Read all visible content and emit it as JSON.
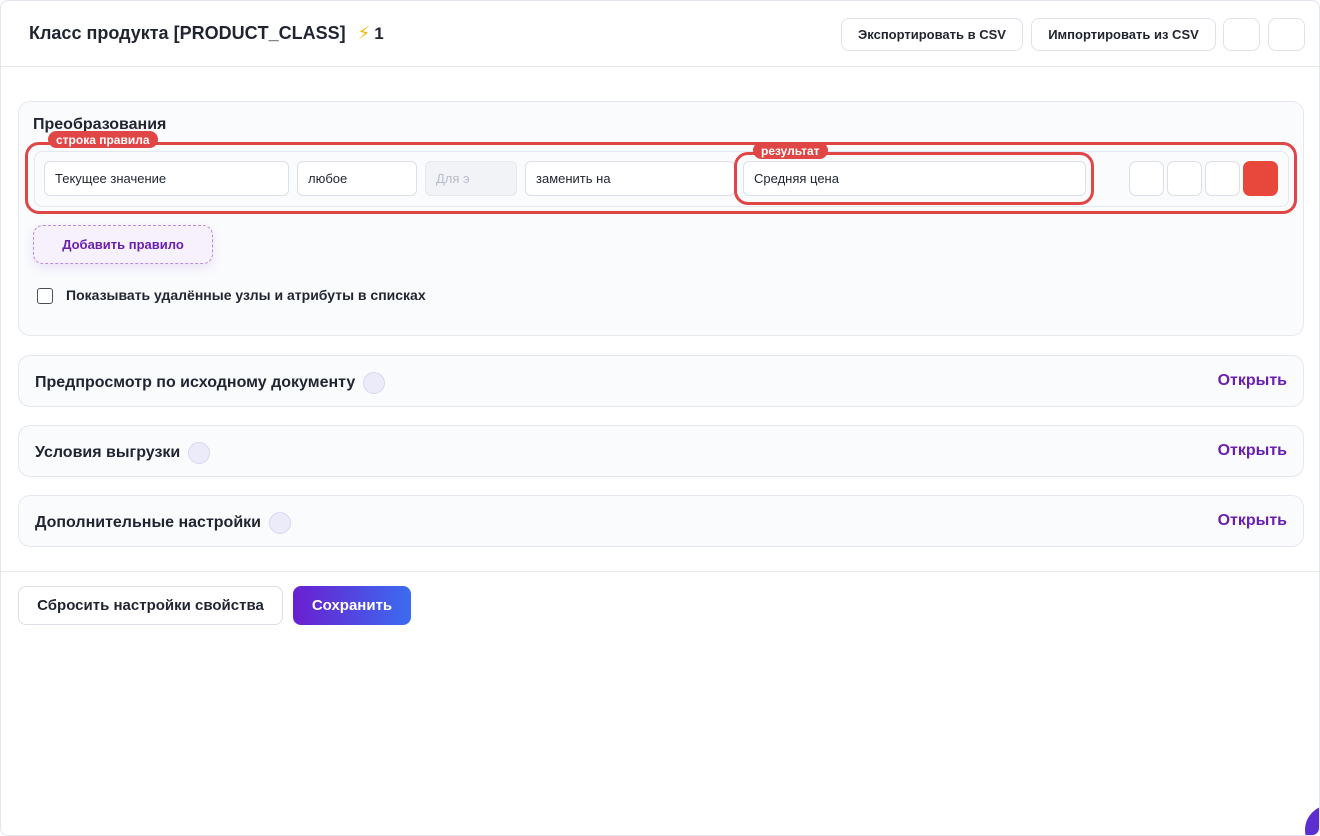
{
  "header": {
    "title": "Класс продукта [PRODUCT_CLASS]",
    "bolt_icon": "⚡",
    "count": "1",
    "export_label": "Экспортировать в CSV",
    "import_label": "Импортировать из CSV"
  },
  "transforms": {
    "title": "Преобразования",
    "row_tag": "строка правила",
    "result_tag": "результат",
    "rule": {
      "source_value": "Текущее значение",
      "condition_value": "любое",
      "for_placeholder": "Для э",
      "action_value": "заменить на",
      "result_value": "Средняя цена"
    },
    "add_rule_label": "Добавить правило",
    "show_deleted_label": "Показывать удалённые узлы и атрибуты в списках",
    "show_deleted_checked": false
  },
  "sections": [
    {
      "title": "Предпросмотр по исходному документу",
      "action": "Открыть"
    },
    {
      "title": "Условия выгрузки",
      "action": "Открыть"
    },
    {
      "title": "Дополнительные настройки",
      "action": "Открыть"
    }
  ],
  "footer": {
    "reset_label": "Сбросить настройки свойства",
    "save_label": "Сохранить"
  },
  "colors": {
    "accent": "#6a1fb0",
    "highlight": "#e04646",
    "delete": "#e8483c"
  }
}
